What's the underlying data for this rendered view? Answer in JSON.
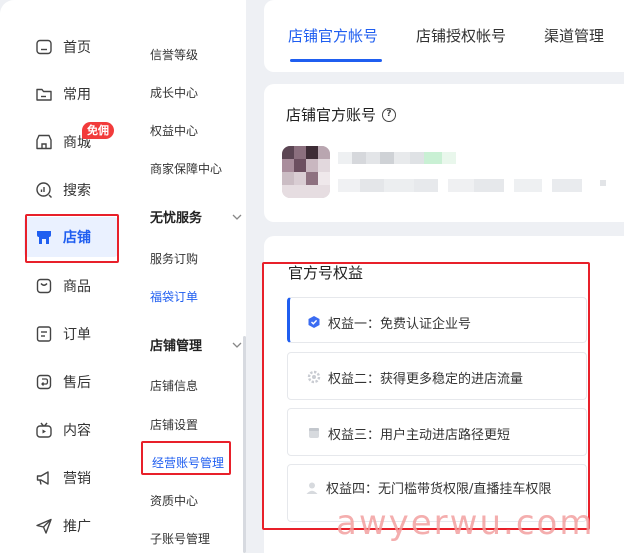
{
  "nav": {
    "items": [
      {
        "label": "首页",
        "icon": "home-icon"
      },
      {
        "label": "常用",
        "icon": "folder-icon"
      },
      {
        "label": "商城",
        "icon": "store-icon",
        "badge": "免佣"
      },
      {
        "label": "搜索",
        "icon": "search-icon"
      },
      {
        "label": "店铺",
        "icon": "shop-icon",
        "active": true
      },
      {
        "label": "商品",
        "icon": "product-icon"
      },
      {
        "label": "订单",
        "icon": "order-icon"
      },
      {
        "label": "售后",
        "icon": "after-sales-icon"
      },
      {
        "label": "内容",
        "icon": "tv-icon"
      },
      {
        "label": "营销",
        "icon": "megaphone-icon"
      },
      {
        "label": "推广",
        "icon": "send-icon"
      }
    ]
  },
  "subnav": {
    "items_top": [
      "信誉等级",
      "成长中心",
      "权益中心",
      "商家保障中心"
    ],
    "group1": {
      "label": "无忧服务",
      "items": [
        "服务订购",
        "福袋订单"
      ]
    },
    "group2": {
      "label": "店铺管理",
      "items": [
        "店铺信息",
        "店铺设置",
        "经营账号管理",
        "资质中心",
        "子账号管理"
      ]
    }
  },
  "tabs": [
    "店铺官方帐号",
    "店铺授权帐号",
    "渠道管理"
  ],
  "account": {
    "title": "店铺官方账号",
    "help": "?"
  },
  "benefits": {
    "title": "官方号权益",
    "items": [
      "权益一：免费认证企业号",
      "权益二：获得更多稳定的进店流量",
      "权益三：用户主动进店路径更短",
      "权益四：无门槛带货权限/直播挂车权限"
    ]
  },
  "watermark": "awyerwu.com",
  "colors": {
    "accent": "#1f5ef0",
    "annotation": "#e8202a",
    "badge": "#f23b3b"
  }
}
